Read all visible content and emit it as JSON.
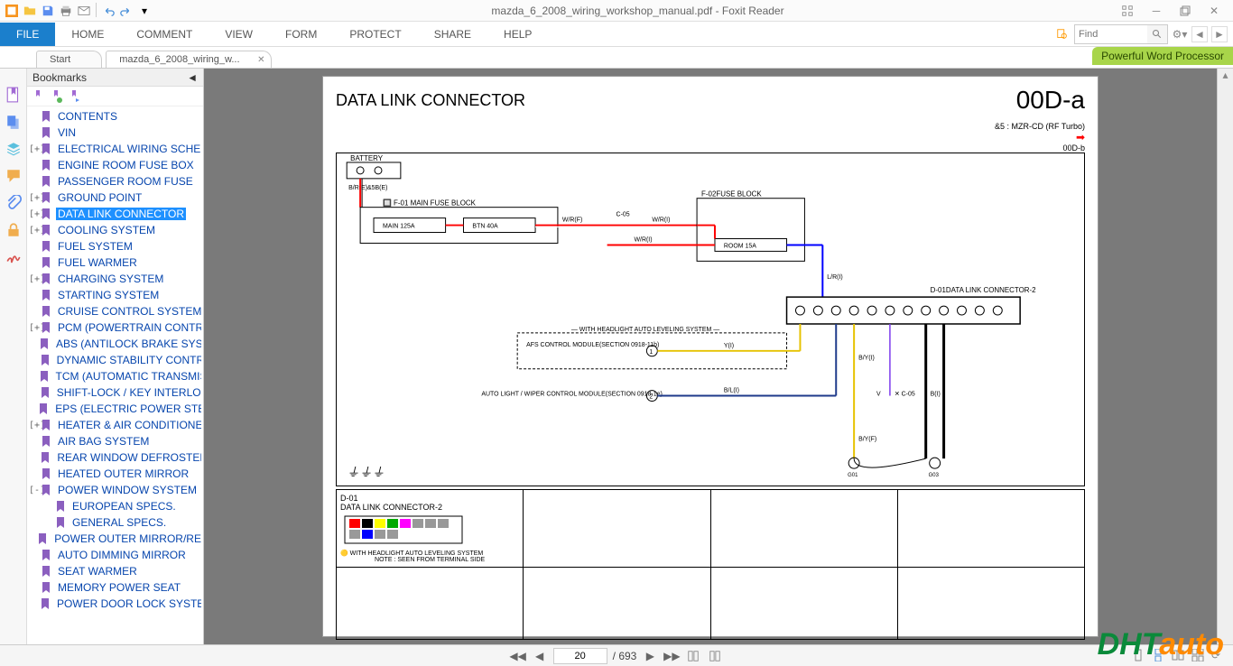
{
  "titlebar": {
    "title": "mazda_6_2008_wiring_workshop_manual.pdf - Foxit Reader"
  },
  "ribbon": {
    "file": "FILE",
    "items": [
      "HOME",
      "COMMENT",
      "VIEW",
      "FORM",
      "PROTECT",
      "SHARE",
      "HELP"
    ],
    "find_placeholder": "Find"
  },
  "promo": "Powerful Word Processor",
  "doctabs": [
    {
      "label": "Start",
      "active": false
    },
    {
      "label": "mazda_6_2008_wiring_w...",
      "active": true
    }
  ],
  "bookmarks": {
    "header": "Bookmarks",
    "items": [
      {
        "label": "CONTENTS",
        "expand": "",
        "selected": false,
        "indent": 0
      },
      {
        "label": "VIN",
        "expand": "",
        "selected": false,
        "indent": 0
      },
      {
        "label": "ELECTRICAL WIRING SCHEMATIC",
        "expand": "+",
        "selected": false,
        "indent": 0
      },
      {
        "label": "ENGINE ROOM FUSE BOX",
        "expand": "",
        "selected": false,
        "indent": 0
      },
      {
        "label": "PASSENGER  ROOM FUSE",
        "expand": "",
        "selected": false,
        "indent": 0
      },
      {
        "label": "GROUND POINT",
        "expand": "+",
        "selected": false,
        "indent": 0
      },
      {
        "label": "DATA LINK CONNECTOR",
        "expand": "+",
        "selected": true,
        "indent": 0
      },
      {
        "label": "COOLING SYSTEM",
        "expand": "+",
        "selected": false,
        "indent": 0
      },
      {
        "label": "FUEL SYSTEM",
        "expand": "",
        "selected": false,
        "indent": 0
      },
      {
        "label": "FUEL WARMER",
        "expand": "",
        "selected": false,
        "indent": 0
      },
      {
        "label": "CHARGING SYSTEM",
        "expand": "+",
        "selected": false,
        "indent": 0
      },
      {
        "label": "STARTING SYSTEM",
        "expand": "",
        "selected": false,
        "indent": 0
      },
      {
        "label": "CRUISE CONTROL SYSTEM",
        "expand": "",
        "selected": false,
        "indent": 0
      },
      {
        "label": "PCM (POWERTRAIN CONTROL)",
        "expand": "+",
        "selected": false,
        "indent": 0
      },
      {
        "label": "ABS (ANTILOCK BRAKE SYSTEM)",
        "expand": "",
        "selected": false,
        "indent": 0
      },
      {
        "label": "DYNAMIC STABILITY CONTROL",
        "expand": "",
        "selected": false,
        "indent": 0
      },
      {
        "label": "TCM (AUTOMATIC TRANSMISSION)",
        "expand": "",
        "selected": false,
        "indent": 0
      },
      {
        "label": "SHIFT-LOCK / KEY INTERLOCK",
        "expand": "",
        "selected": false,
        "indent": 0
      },
      {
        "label": "EPS (ELECTRIC POWER STEERING)",
        "expand": "",
        "selected": false,
        "indent": 0
      },
      {
        "label": "HEATER & AIR CONDITIONER",
        "expand": "+",
        "selected": false,
        "indent": 0
      },
      {
        "label": "AIR BAG SYSTEM",
        "expand": "",
        "selected": false,
        "indent": 0
      },
      {
        "label": "REAR WINDOW DEFROSTER",
        "expand": "",
        "selected": false,
        "indent": 0
      },
      {
        "label": "HEATED OUTER MIRROR",
        "expand": "",
        "selected": false,
        "indent": 0
      },
      {
        "label": "POWER WINDOW SYSTEM",
        "expand": "-",
        "selected": false,
        "indent": 0
      },
      {
        "label": "EUROPEAN SPECS.",
        "expand": "",
        "selected": false,
        "indent": 1
      },
      {
        "label": "GENERAL SPECS.",
        "expand": "",
        "selected": false,
        "indent": 1
      },
      {
        "label": "POWER OUTER MIRROR/RETRACTABLE",
        "expand": "",
        "selected": false,
        "indent": 0
      },
      {
        "label": "AUTO DIMMING MIRROR",
        "expand": "",
        "selected": false,
        "indent": 0
      },
      {
        "label": "SEAT WARMER",
        "expand": "",
        "selected": false,
        "indent": 0
      },
      {
        "label": "MEMORY POWER SEAT",
        "expand": "",
        "selected": false,
        "indent": 0
      },
      {
        "label": "POWER DOOR LOCK SYSTEM",
        "expand": "",
        "selected": false,
        "indent": 0
      }
    ]
  },
  "page": {
    "title": "DATA LINK CONNECTOR",
    "code": "00D-a",
    "note_top": "&5 : MZR-CD (RF Turbo)",
    "continue_ref": "00D-b",
    "battery": "BATTERY",
    "battery_wire": "B/R(E)\n&5B(E)",
    "main_fuse_block": "F-01  MAIN FUSE BLOCK",
    "fuse_main": "MAIN 125A",
    "fuse_btn": "BTN 40A",
    "wire_wrf": "W/R(F)",
    "wire_c05": "C-05",
    "wire_wri": "W/R(I)",
    "fuse_block": "F-02\nFUSE BLOCK",
    "fuse_room": "ROOM 15A",
    "wire_lri": "L/R(I)",
    "connector_d01": "D-01\nDATA LINK CONNECTOR-2",
    "afs_module_box": "WITH HEADLIGHT AUTO LEVELING SYSTEM",
    "afs_module": "AFS CONTROL MODULE\n(SECTION 0918-11b)",
    "wire_yi": "Y(I)",
    "wire_byi": "B/Y(I)",
    "wire_byf": "B/Y(F)",
    "auto_light_module": "AUTO LIGHT / WIPER CONTROL MODULE\n(SECTION 0918-1e)",
    "wire_bli": "B/L(I)",
    "wire_v": "V",
    "wire_c05b": "C-05",
    "wire_bi": "B(I)",
    "gnd_g01": "G01",
    "gnd_g03": "G03",
    "table_d01": "D-01\nDATA LINK CONNECTOR-2",
    "table_note1": "WITH HEADLIGHT AUTO LEVELING SYSTEM",
    "table_note2": "NOTE : SEEN FROM TERMINAL SIDE"
  },
  "statusbar": {
    "page_current": "20",
    "page_total": "693"
  },
  "watermark": {
    "part1": "DHT",
    "part2": "auto"
  }
}
